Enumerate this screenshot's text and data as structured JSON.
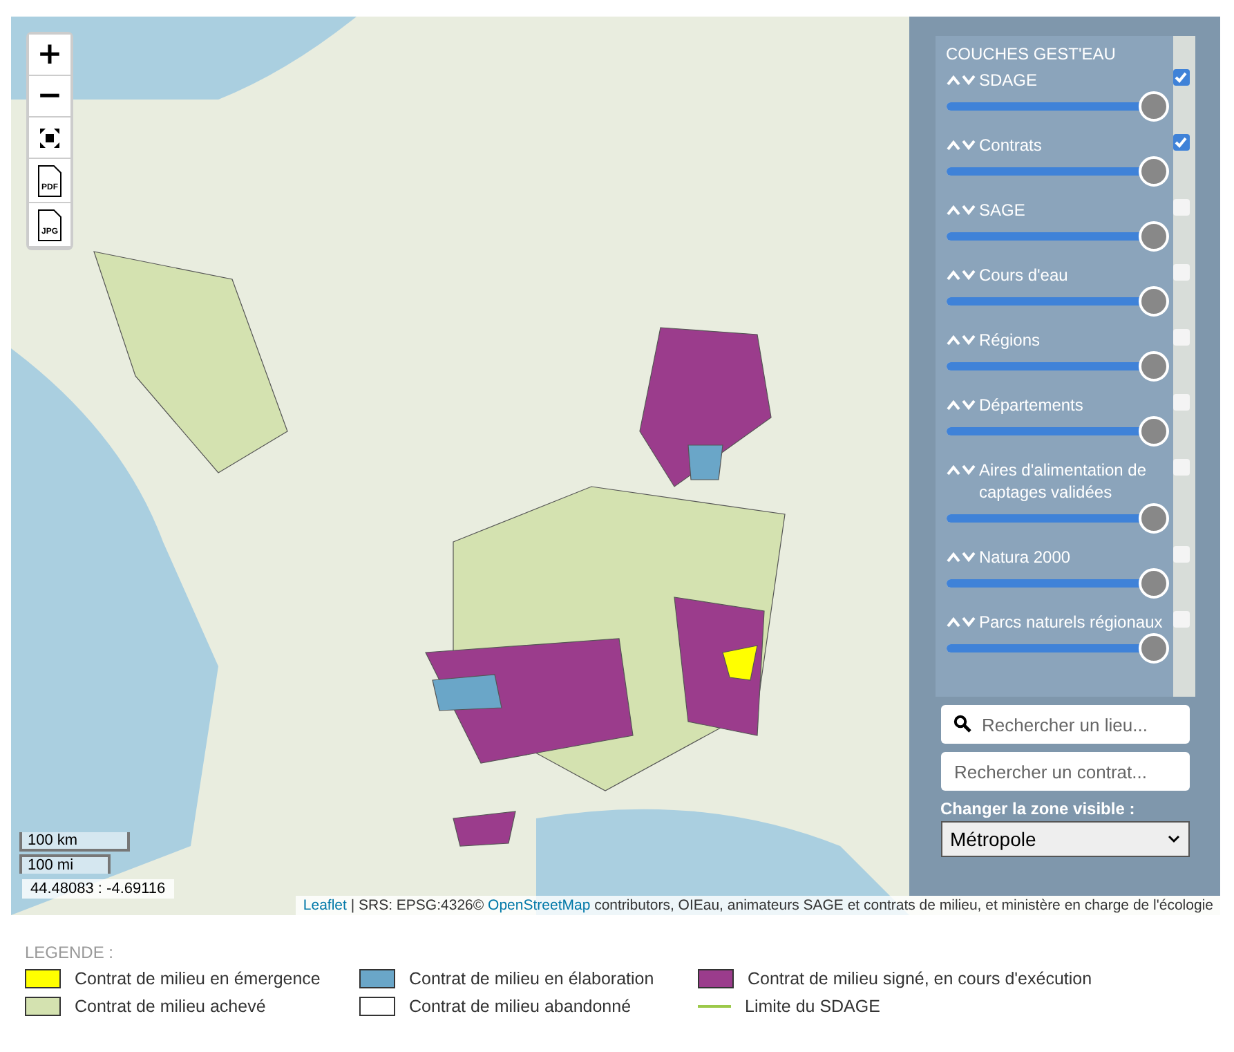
{
  "map": {
    "zoom_in": "+",
    "zoom_out": "−",
    "export_buttons": [
      {
        "label": "PDF"
      },
      {
        "label": "JPG"
      }
    ],
    "layers_panel": {
      "title": "COUCHES GEST'EAU",
      "layers": [
        {
          "name": "SDAGE",
          "checked": true,
          "level": 1
        },
        {
          "name": "Contrats",
          "checked": true,
          "level": 1
        },
        {
          "name": "SAGE",
          "checked": false,
          "level": 1
        },
        {
          "name": "Cours d'eau",
          "checked": false,
          "level": 1
        },
        {
          "name": "Régions",
          "checked": false,
          "level": 1
        },
        {
          "name": "Départements",
          "checked": false,
          "level": 1
        },
        {
          "name": "Aires d'alimentation de captages validées",
          "checked": false,
          "level": 1
        },
        {
          "name": "Natura 2000",
          "checked": false,
          "level": 1
        },
        {
          "name": "Parcs naturels régionaux",
          "checked": false,
          "level": 1
        }
      ]
    },
    "search_place": {
      "placeholder": "Rechercher un lieu..."
    },
    "search_contract": {
      "placeholder": "Rechercher un contrat..."
    },
    "zone": {
      "label": "Changer la zone visible :",
      "value": "Métropole"
    },
    "scale": {
      "metric": "100 km",
      "imperial": "100 mi"
    },
    "coordinates": "44.48083 : -4.69116",
    "attribution": [
      {
        "text": "Leaflet",
        "kind": "link"
      },
      {
        "text": " | SRS: EPSG:4326© ",
        "kind": "text"
      },
      {
        "text": "OpenStreetMap",
        "kind": "link"
      },
      {
        "text": " contributors, OIEau, animateurs SAGE et contrats de milieu, et ministère en charge de l'écologie",
        "kind": "text"
      }
    ]
  },
  "legend": {
    "title": "LEGENDE :",
    "items": [
      {
        "label": "Contrat de milieu en émergence",
        "kind": "fill",
        "color": "#ffff00"
      },
      {
        "label": "Contrat de milieu en élaboration",
        "kind": "fill",
        "color": "#6aa6c8"
      },
      {
        "label": "Contrat de milieu signé, en cours d'exécution",
        "kind": "fill",
        "color": "#9b3c8c"
      },
      {
        "label": "Contrat de milieu achevé",
        "kind": "fill",
        "color": "#d4e2b0"
      },
      {
        "label": "Contrat de milieu abandonné",
        "kind": "fill",
        "color": "#ffffff"
      },
      {
        "label": "Limite du SDAGE",
        "kind": "line",
        "color": "#9cc94a"
      }
    ]
  }
}
